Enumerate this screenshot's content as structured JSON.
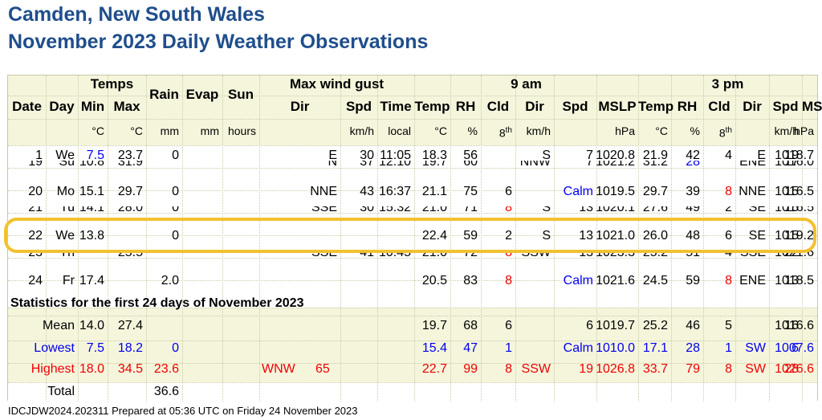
{
  "title": "Camden, New South Wales",
  "subtitle": "November 2023 Daily Weather Observations",
  "headers": {
    "group": {
      "temps": "Temps",
      "rain": "Rain",
      "evap": "Evap",
      "sun": "Sun",
      "gust": "Max wind gust",
      "am": "9 am",
      "pm": "3 pm"
    },
    "cols": [
      "Date",
      "Day",
      "Min",
      "Max",
      "Dir",
      "Spd",
      "Time",
      "Temp",
      "RH",
      "Cld",
      "Dir",
      "Spd",
      "MSLP",
      "Temp",
      "RH",
      "Cld",
      "Dir",
      "Spd",
      "MSLP"
    ],
    "units": [
      "°C",
      "°C",
      "mm",
      "mm",
      "hours",
      "km/h",
      "local",
      "°C",
      "%",
      "8",
      "km/h",
      "hPa",
      "°C",
      "%",
      "8",
      "km/h",
      "hPa"
    ],
    "th": "th"
  },
  "rows": {
    "r1": [
      "1",
      "We",
      "7.5",
      "23.7",
      "0",
      "",
      "",
      "",
      "E",
      "30",
      "11:05",
      "18.3",
      "56",
      "",
      "S",
      "7",
      "1020.8",
      "21.9",
      "42",
      "4",
      "E",
      "19",
      "1018.7"
    ],
    "r19": [
      "19",
      "Su",
      "10.8",
      "31.9",
      "",
      "",
      "",
      "",
      "N",
      "37",
      "12:10",
      "19.7",
      "60",
      "",
      "NNW",
      "7",
      "1021.2",
      "31.2",
      "28",
      "",
      "ENE",
      "17",
      "1016.0"
    ],
    "r20": [
      "20",
      "Mo",
      "15.1",
      "29.7",
      "0",
      "",
      "",
      "",
      "NNE",
      "43",
      "16:37",
      "21.1",
      "75",
      "6",
      "",
      "Calm",
      "1019.5",
      "29.7",
      "39",
      "8",
      "NNE",
      "15",
      "1016.5"
    ],
    "r21": [
      "21",
      "Tu",
      "14.1",
      "28.0",
      "0",
      "",
      "",
      "",
      "SSE",
      "30",
      "15:32",
      "21.0",
      "71",
      "8",
      "S",
      "13",
      "1020.1",
      "27.6",
      "49",
      "2",
      "SE",
      "15",
      "1016.5"
    ],
    "r22": [
      "22",
      "We",
      "13.8",
      "",
      "0",
      "",
      "",
      "",
      "",
      "",
      "",
      "22.4",
      "59",
      "2",
      "S",
      "13",
      "1021.0",
      "26.0",
      "48",
      "6",
      "SE",
      "15",
      "1019.2"
    ],
    "r23": [
      "23",
      "Th",
      "",
      "25.5",
      "",
      "",
      "",
      "",
      "SSE",
      "41",
      "10:45",
      "21.0",
      "72",
      "8",
      "SSW",
      "13",
      "1023.3",
      "25.2",
      "51",
      "4",
      "SSE",
      "22",
      "1021.6"
    ],
    "r24": [
      "24",
      "Fr",
      "17.4",
      "",
      "2.0",
      "",
      "",
      "",
      "",
      "",
      "",
      "20.5",
      "83",
      "8",
      "",
      "Calm",
      "1021.6",
      "24.5",
      "59",
      "8",
      "ENE",
      "13",
      "1018.5"
    ]
  },
  "stats_title": "Statistics for the first 24 days of November 2023",
  "stats": {
    "mean": [
      "Mean",
      "14.0",
      "27.4",
      "",
      "",
      "",
      "",
      "",
      "19.7",
      "68",
      "6",
      "",
      "6",
      "1019.7",
      "25.2",
      "46",
      "5",
      "",
      "16",
      "1016.6"
    ],
    "lowest": [
      "Lowest",
      "7.5",
      "18.2",
      "0",
      "",
      "",
      "",
      "",
      "15.4",
      "47",
      "1",
      "",
      "Calm",
      "1010.0",
      "17.1",
      "28",
      "1",
      "SW",
      "6",
      "1007.6"
    ],
    "highest": [
      "Highest",
      "18.0",
      "34.5",
      "23.6",
      "",
      "WNW",
      "65",
      "",
      "22.7",
      "99",
      "8",
      "SSW",
      "19",
      "1026.8",
      "33.7",
      "79",
      "8",
      "SW",
      "28",
      "1026.6"
    ],
    "total": [
      "Total",
      "",
      "",
      "36.6"
    ]
  },
  "footer": "IDCJDW2024.202311   Prepared at 05:36 UTC on Friday 24 November 2023",
  "colors": {
    "title": "#1f4e8c",
    "low": "#0000ee",
    "high": "#ee0000",
    "highlight": "#f2c12e",
    "header_bg": "#f5f5dc"
  }
}
